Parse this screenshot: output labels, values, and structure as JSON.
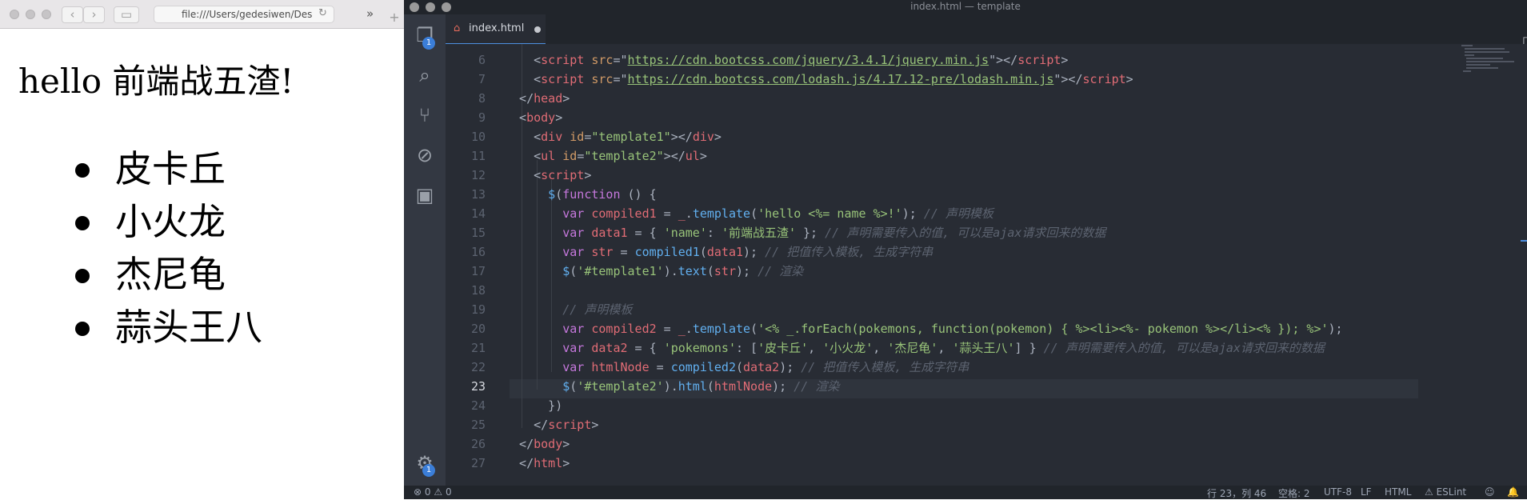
{
  "browser": {
    "url": "file:///Users/gedesiwen/Des",
    "heading": "hello 前端战五渣!",
    "list_items": [
      "皮卡丘",
      "小火龙",
      "杰尼龟",
      "蒜头王八"
    ]
  },
  "editor": {
    "window_title": "index.html — template",
    "tab_label": "index.html",
    "activity_badges": {
      "explorer": "1",
      "settings": "1"
    },
    "active_line": 23,
    "lines": [
      {
        "n": 6,
        "tokens": [
          [
            "t-pun",
            "    <"
          ],
          [
            "t-tag",
            "script"
          ],
          [
            "t-pun",
            " "
          ],
          [
            "t-attr",
            "src"
          ],
          [
            "t-pun",
            "=\""
          ],
          [
            "t-link",
            "https://cdn.bootcss.com/jquery/3.4.1/jquery.min.js"
          ],
          [
            "t-pun",
            "\"></"
          ],
          [
            "t-tag",
            "script"
          ],
          [
            "t-pun",
            ">"
          ]
        ]
      },
      {
        "n": 7,
        "tokens": [
          [
            "t-pun",
            "    <"
          ],
          [
            "t-tag",
            "script"
          ],
          [
            "t-pun",
            " "
          ],
          [
            "t-attr",
            "src"
          ],
          [
            "t-pun",
            "=\""
          ],
          [
            "t-link",
            "https://cdn.bootcss.com/lodash.js/4.17.12-pre/lodash.min.js"
          ],
          [
            "t-pun",
            "\"></"
          ],
          [
            "t-tag",
            "script"
          ],
          [
            "t-pun",
            ">"
          ]
        ]
      },
      {
        "n": 8,
        "tokens": [
          [
            "t-pun",
            "  </"
          ],
          [
            "t-tag",
            "head"
          ],
          [
            "t-pun",
            ">"
          ]
        ]
      },
      {
        "n": 9,
        "tokens": [
          [
            "t-pun",
            "  <"
          ],
          [
            "t-tag",
            "body"
          ],
          [
            "t-pun",
            ">"
          ]
        ]
      },
      {
        "n": 10,
        "tokens": [
          [
            "t-pun",
            "    <"
          ],
          [
            "t-tag",
            "div"
          ],
          [
            "t-pun",
            " "
          ],
          [
            "t-attr",
            "id"
          ],
          [
            "t-pun",
            "="
          ],
          [
            "t-str",
            "\"template1\""
          ],
          [
            "t-pun",
            "></"
          ],
          [
            "t-tag",
            "div"
          ],
          [
            "t-pun",
            ">"
          ]
        ]
      },
      {
        "n": 11,
        "tokens": [
          [
            "t-pun",
            "    <"
          ],
          [
            "t-tag",
            "ul"
          ],
          [
            "t-pun",
            " "
          ],
          [
            "t-attr",
            "id"
          ],
          [
            "t-pun",
            "="
          ],
          [
            "t-str",
            "\"template2\""
          ],
          [
            "t-pun",
            "></"
          ],
          [
            "t-tag",
            "ul"
          ],
          [
            "t-pun",
            ">"
          ]
        ]
      },
      {
        "n": 12,
        "tokens": [
          [
            "t-pun",
            "    <"
          ],
          [
            "t-tag",
            "script"
          ],
          [
            "t-pun",
            ">"
          ]
        ]
      },
      {
        "n": 13,
        "tokens": [
          [
            "t-fn",
            "      $"
          ],
          [
            "t-pun",
            "("
          ],
          [
            "t-kw",
            "function"
          ],
          [
            "t-pun",
            " () {"
          ]
        ]
      },
      {
        "n": 14,
        "tokens": [
          [
            "t-kw",
            "        var"
          ],
          [
            "t-pun",
            " "
          ],
          [
            "t-var",
            "compiled1"
          ],
          [
            "t-pun",
            " = "
          ],
          [
            "t-var",
            "_"
          ],
          [
            "t-pun",
            "."
          ],
          [
            "t-fn",
            "template"
          ],
          [
            "t-pun",
            "("
          ],
          [
            "t-str",
            "'hello <%= name %>!'"
          ],
          [
            "t-pun",
            "); "
          ],
          [
            "t-cmt",
            "// 声明模板"
          ]
        ]
      },
      {
        "n": 15,
        "tokens": [
          [
            "t-kw",
            "        var"
          ],
          [
            "t-pun",
            " "
          ],
          [
            "t-var",
            "data1"
          ],
          [
            "t-pun",
            " = { "
          ],
          [
            "t-str",
            "'name'"
          ],
          [
            "t-pun",
            ": "
          ],
          [
            "t-str",
            "'前端战五渣'"
          ],
          [
            "t-pun",
            " }; "
          ],
          [
            "t-cmt",
            "// 声明需要传入的值, 可以是ajax请求回来的数据"
          ]
        ]
      },
      {
        "n": 16,
        "tokens": [
          [
            "t-kw",
            "        var"
          ],
          [
            "t-pun",
            " "
          ],
          [
            "t-var",
            "str"
          ],
          [
            "t-pun",
            " = "
          ],
          [
            "t-fn",
            "compiled1"
          ],
          [
            "t-pun",
            "("
          ],
          [
            "t-var",
            "data1"
          ],
          [
            "t-pun",
            "); "
          ],
          [
            "t-cmt",
            "// 把值传入模板, 生成字符串"
          ]
        ]
      },
      {
        "n": 17,
        "tokens": [
          [
            "t-fn",
            "        $"
          ],
          [
            "t-pun",
            "("
          ],
          [
            "t-str",
            "'#template1'"
          ],
          [
            "t-pun",
            ")."
          ],
          [
            "t-fn",
            "text"
          ],
          [
            "t-pun",
            "("
          ],
          [
            "t-var",
            "str"
          ],
          [
            "t-pun",
            "); "
          ],
          [
            "t-cmt",
            "// 渲染"
          ]
        ]
      },
      {
        "n": 18,
        "tokens": [
          [
            "t-pun",
            ""
          ]
        ]
      },
      {
        "n": 19,
        "tokens": [
          [
            "t-cmt",
            "        // 声明模板"
          ]
        ]
      },
      {
        "n": 20,
        "tokens": [
          [
            "t-kw",
            "        var"
          ],
          [
            "t-pun",
            " "
          ],
          [
            "t-var",
            "compiled2"
          ],
          [
            "t-pun",
            " = "
          ],
          [
            "t-var",
            "_"
          ],
          [
            "t-pun",
            "."
          ],
          [
            "t-fn",
            "template"
          ],
          [
            "t-pun",
            "("
          ],
          [
            "t-str",
            "'<% _.forEach(pokemons, function(pokemon) { %><li><%- pokemon %></li><% }); %>'"
          ],
          [
            "t-pun",
            ");"
          ]
        ]
      },
      {
        "n": 21,
        "tokens": [
          [
            "t-kw",
            "        var"
          ],
          [
            "t-pun",
            " "
          ],
          [
            "t-var",
            "data2"
          ],
          [
            "t-pun",
            " = { "
          ],
          [
            "t-str",
            "'pokemons'"
          ],
          [
            "t-pun",
            ": ["
          ],
          [
            "t-str",
            "'皮卡丘'"
          ],
          [
            "t-pun",
            ", "
          ],
          [
            "t-str",
            "'小火龙'"
          ],
          [
            "t-pun",
            ", "
          ],
          [
            "t-str",
            "'杰尼龟'"
          ],
          [
            "t-pun",
            ", "
          ],
          [
            "t-str",
            "'蒜头王八'"
          ],
          [
            "t-pun",
            "] } "
          ],
          [
            "t-cmt",
            "// 声明需要传入的值, 可以是ajax请求回来的数据"
          ]
        ]
      },
      {
        "n": 22,
        "tokens": [
          [
            "t-kw",
            "        var"
          ],
          [
            "t-pun",
            " "
          ],
          [
            "t-var",
            "htmlNode"
          ],
          [
            "t-pun",
            " = "
          ],
          [
            "t-fn",
            "compiled2"
          ],
          [
            "t-pun",
            "("
          ],
          [
            "t-var",
            "data2"
          ],
          [
            "t-pun",
            "); "
          ],
          [
            "t-cmt",
            "// 把值传入模板, 生成字符串"
          ]
        ]
      },
      {
        "n": 23,
        "tokens": [
          [
            "t-fn",
            "        $"
          ],
          [
            "t-pun",
            "("
          ],
          [
            "t-str",
            "'#template2'"
          ],
          [
            "t-pun",
            ")."
          ],
          [
            "t-fn",
            "html"
          ],
          [
            "t-pun",
            "("
          ],
          [
            "t-var",
            "htmlNode"
          ],
          [
            "t-pun",
            "); "
          ],
          [
            "t-cmt",
            "// 渲染"
          ]
        ]
      },
      {
        "n": 24,
        "tokens": [
          [
            "t-pun",
            "      })"
          ]
        ]
      },
      {
        "n": 25,
        "tokens": [
          [
            "t-pun",
            "    </"
          ],
          [
            "t-tag",
            "script"
          ],
          [
            "t-pun",
            ">"
          ]
        ]
      },
      {
        "n": 26,
        "tokens": [
          [
            "t-pun",
            "  </"
          ],
          [
            "t-tag",
            "body"
          ],
          [
            "t-pun",
            ">"
          ]
        ]
      },
      {
        "n": 27,
        "tokens": [
          [
            "t-pun",
            "  </"
          ],
          [
            "t-tag",
            "html"
          ],
          [
            "t-pun",
            ">"
          ]
        ]
      }
    ]
  },
  "statusbar": {
    "errors": "0",
    "warnings": "0",
    "position": "行 23，列 46",
    "spaces": "空格: 2",
    "encoding": "UTF-8",
    "eol": "LF",
    "language": "HTML",
    "linter": "ESLint"
  }
}
